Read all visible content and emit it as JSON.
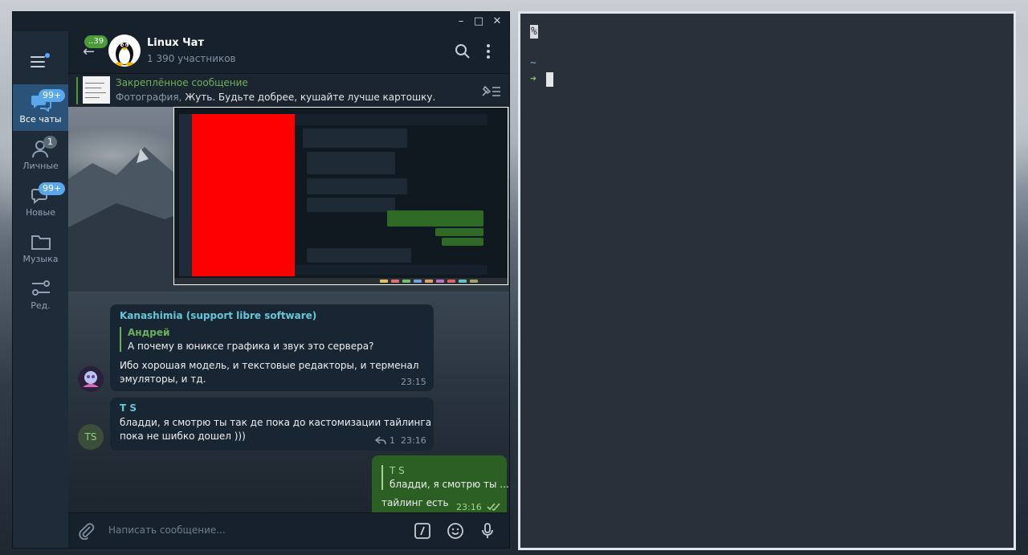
{
  "window": {
    "minimize": "–",
    "maximize": "□",
    "close": "✕"
  },
  "sidebar": {
    "items": [
      {
        "label": "Все чаты",
        "badge": "99+",
        "icon": "chats-icon",
        "active": true
      },
      {
        "label": "Личные",
        "badge": "1",
        "icon": "person-icon"
      },
      {
        "label": "Новые",
        "badge": "99+",
        "icon": "chat-new-icon"
      },
      {
        "label": "Музыка",
        "badge": "",
        "icon": "folder-icon"
      },
      {
        "label": "Ред.",
        "badge": "",
        "icon": "sliders-icon"
      }
    ]
  },
  "header": {
    "back_badge": "..39",
    "title": "Linux Чат",
    "subtitle": "1 390 участников"
  },
  "pinned": {
    "title": "Закреплённое сообщение",
    "prefix": "Фотография,",
    "text": " Жуть. Будьте добрее, кушайте лучше картошку."
  },
  "messages": [
    {
      "author": "Kanashimia (support libre software)",
      "reply_author": "Андрей",
      "reply_text": "А почему в юниксе графика и звук это сервера?",
      "text_line1": "Ибо хорошая модель, и текстовые редакторы, и терменал",
      "text_line2": "эмуляторы, и тд.",
      "time": "23:15"
    },
    {
      "author": "T S",
      "avatar_initials": "TS",
      "text_line1": "бладди, я смотрю ты так де пока до кастомизации тайлинга",
      "text_line2": "пока не шибко дошел )))",
      "replies": "1",
      "time": "23:16"
    },
    {
      "reply_author": "T S",
      "reply_text": "бладди, я смотрю ты ...",
      "text": "тайлинг есть",
      "time": "23:16"
    }
  ],
  "input": {
    "placeholder": "Написать сообщение..."
  },
  "terminal": {
    "line1": "%",
    "line2": "~",
    "line3": "➜"
  },
  "colors": {
    "accent": "#5aa7ec",
    "green": "#6cb05a",
    "out_bubble": "#2b5f23",
    "sidebar": "#1e2c3a"
  }
}
